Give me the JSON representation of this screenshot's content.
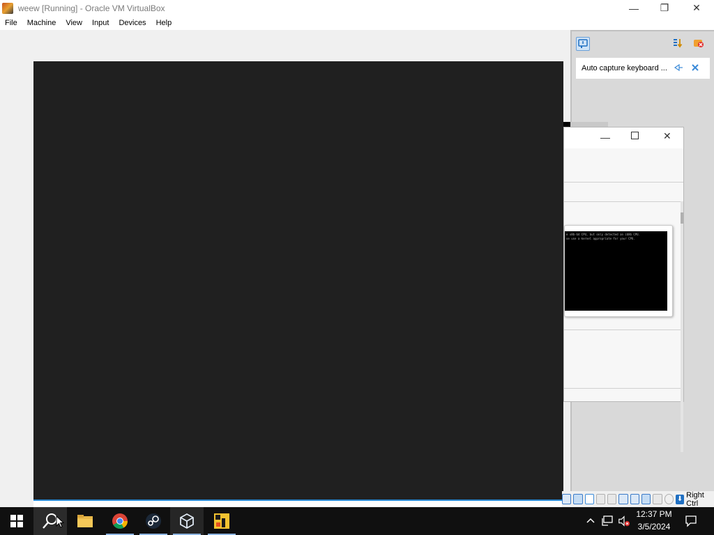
{
  "window": {
    "title": "weew [Running] - Oracle VM VirtualBox",
    "controls": {
      "minimize": "—",
      "restore": "❐",
      "close": "✕"
    }
  },
  "menu": {
    "items": [
      "File",
      "Machine",
      "View",
      "Input",
      "Devices",
      "Help"
    ]
  },
  "notification": {
    "message": "Auto capture keyboard ..."
  },
  "guest_window": {
    "console_line_1": "e x86-64 CPU, but only detected an i686 CPU.",
    "console_line_2": "se use a kernel appropriate for your CPU."
  },
  "statusbar": {
    "host_key": "Right Ctrl"
  },
  "taskbar": {
    "pinned": [
      "start-icon",
      "search-icon",
      "file-explorer-icon",
      "chrome-icon",
      "steam-icon",
      "virtualbox-icon",
      "app-icon"
    ]
  },
  "tray": {
    "time": "12:37 PM",
    "date": "3/5/2024"
  },
  "colors": {
    "vm_screen": "#202020",
    "taskbar": "#101010",
    "accent": "#2a8ad4"
  }
}
